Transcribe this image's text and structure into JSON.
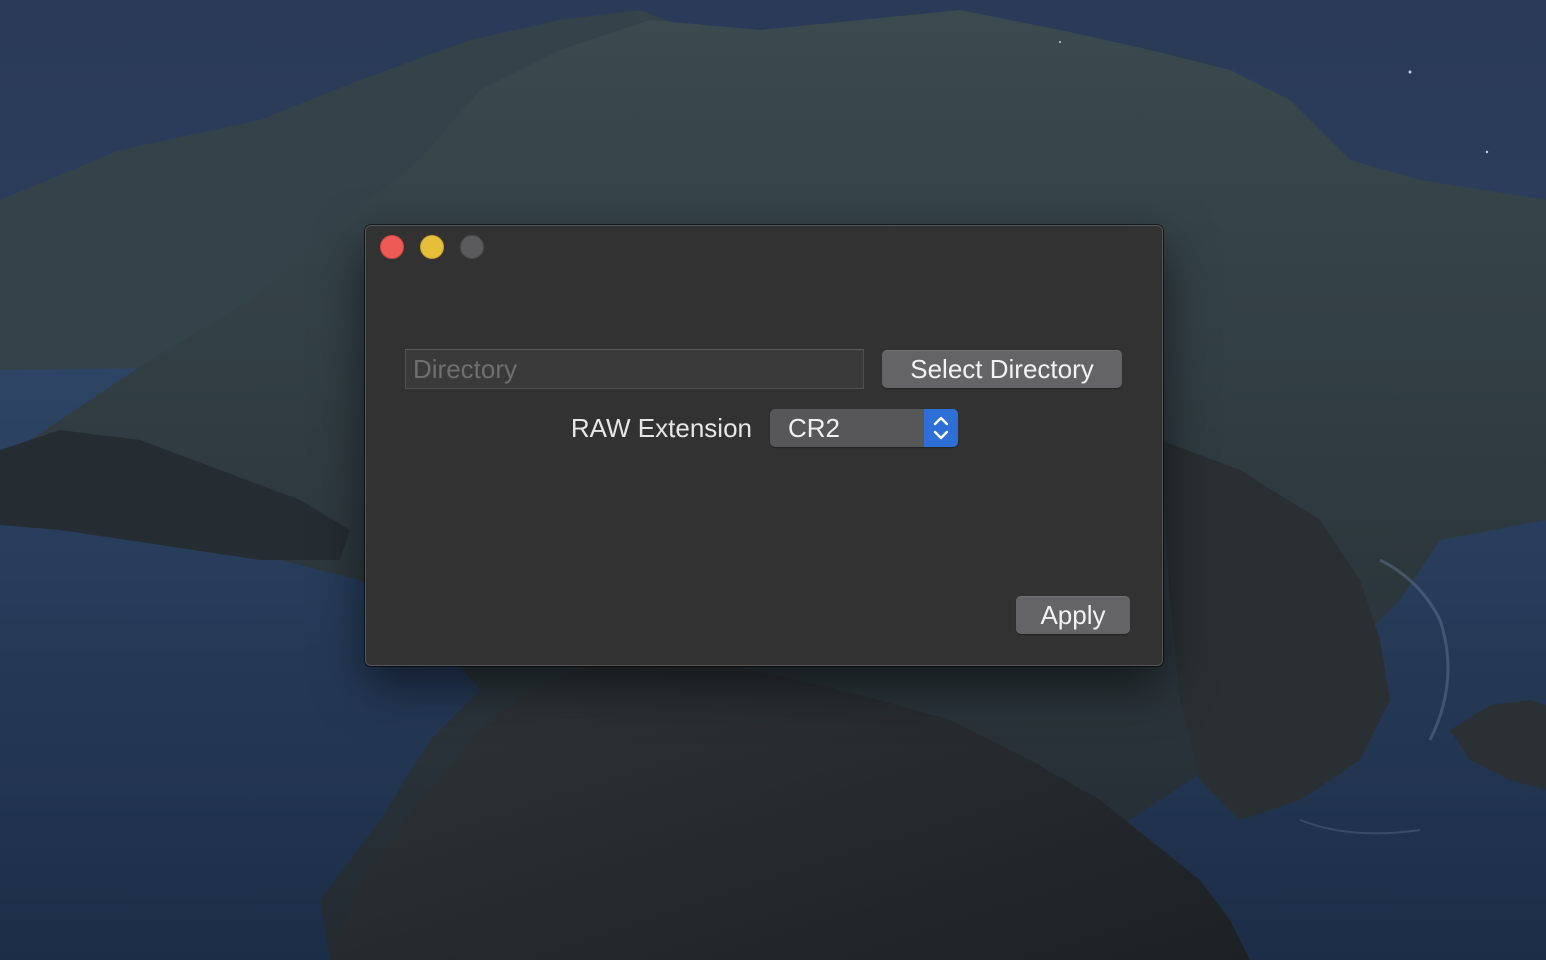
{
  "window": {
    "controls": {
      "close": "close-icon",
      "minimize": "minimize-icon",
      "zoom": "zoom-icon"
    }
  },
  "form": {
    "directory_placeholder": "Directory",
    "directory_value": "",
    "select_directory_label": "Select Directory",
    "raw_extension_label": "RAW Extension",
    "raw_extension_selected": "CR2",
    "apply_label": "Apply"
  },
  "colors": {
    "close": "#ee5a56",
    "minimize": "#e6bf3a",
    "zoom_disabled": "#5b5b5d",
    "accent": "#2d6fd6",
    "window_bg": "#323232"
  }
}
